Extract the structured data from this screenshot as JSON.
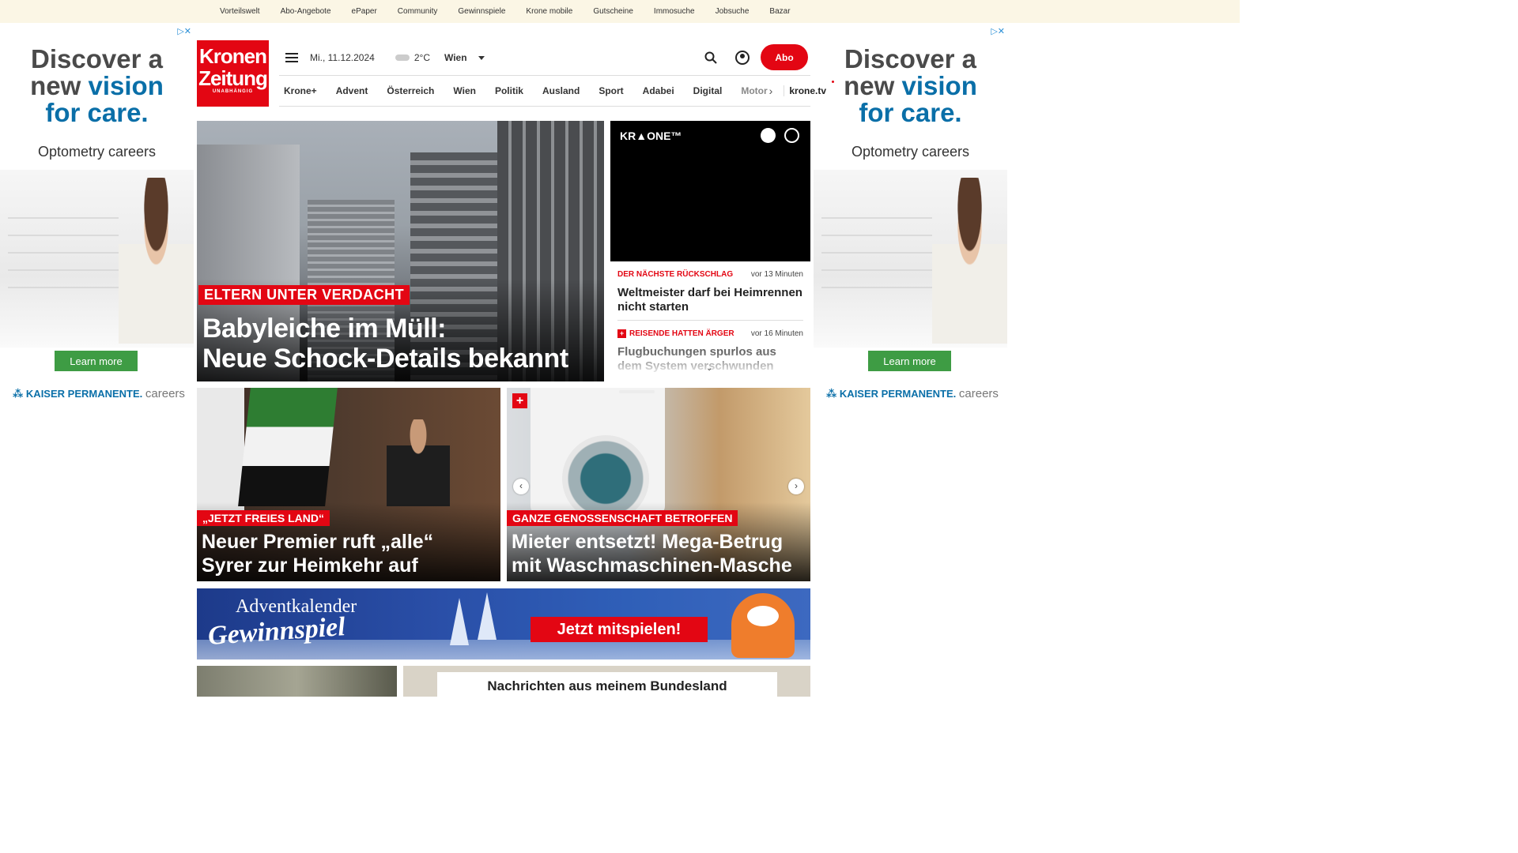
{
  "topbar": {
    "links": [
      "Vorteilswelt",
      "Abo-Angebote",
      "ePaper",
      "Community",
      "Gewinnspiele",
      "Krone mobile",
      "Gutscheine",
      "Immosuche",
      "Jobsuche",
      "Bazar"
    ]
  },
  "ad": {
    "headline_part1": "Discover a",
    "headline_part2": "new ",
    "headline_highlight1": "vision",
    "headline_highlight2": "for care.",
    "sub": "Optometry careers",
    "button": "Learn more",
    "brand": "KAISER PERMANENTE.",
    "brand_suffix": "careers",
    "adchoices": "▷✕"
  },
  "logo": {
    "line1": "Kronen",
    "line2": "Zeitung",
    "line3": "UNABHÄNGIG"
  },
  "header": {
    "date": "Mi., 11.12.2024",
    "temperature": "2°C",
    "city": "Wien",
    "abo_label": "Abo"
  },
  "nav": {
    "items": [
      "Krone+",
      "Advent",
      "Österreich",
      "Wien",
      "Politik",
      "Ausland",
      "Sport",
      "Adabei",
      "Digital",
      "Motor"
    ],
    "more": "›",
    "tv": "krone.tv"
  },
  "hero": {
    "kicker": "ELTERN UNTER VERDACHT",
    "title_line1": "Babyleiche im Müll:",
    "title_line2": "Neue Schock-Details bekannt"
  },
  "video": {
    "brand": "KR▲ONE™"
  },
  "ticker": [
    {
      "kicker": "DER NÄCHSTE RÜCKSCHLAG",
      "time": "vor 13 Minuten",
      "title": "Weltmeister darf bei Heimrennen nicht starten",
      "plus": false
    },
    {
      "kicker": "REISENDE HATTEN ÄRGER",
      "time": "vor 16 Minuten",
      "title": "Flugbuchungen spurlos aus dem System verschwunden",
      "plus": true
    }
  ],
  "cards": [
    {
      "kicker": "„JETZT FREIES LAND“",
      "title_line1": "Neuer Premier ruft „alle“",
      "title_line2": "Syrer zur Heimkehr auf"
    },
    {
      "kicker": "GANZE GENOSSENSCHAFT BETROFFEN",
      "title_line1": "Mieter entsetzt! Mega-Betrug",
      "title_line2": "mit Waschmaschinen-Masche"
    }
  ],
  "promo": {
    "line1": "Adventkalender",
    "line2": "Gewinnspiel",
    "cta": "Jetzt mitspielen!"
  },
  "bundesland": {
    "title": "Nachrichten aus meinem Bundesland"
  },
  "colors": {
    "brand_red": "#e30613",
    "topbar_bg": "#fbf6e5",
    "ad_blue": "#0a6fa8",
    "ad_green": "#3e9c44"
  }
}
